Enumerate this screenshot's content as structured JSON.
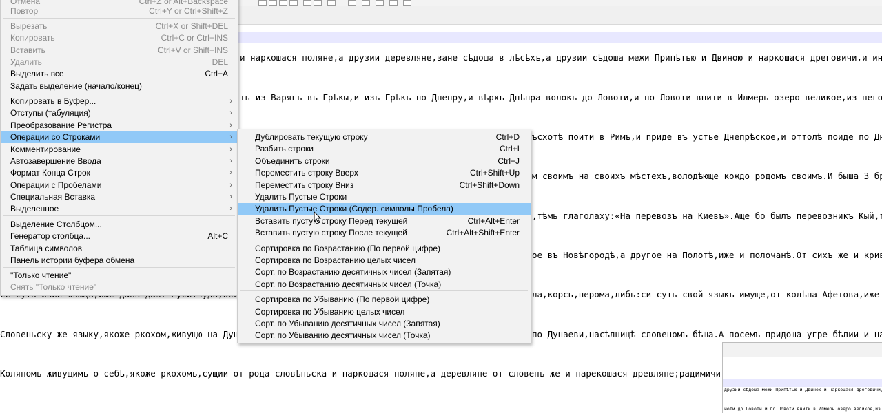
{
  "editor": {
    "lines": [
      {
        "text": "и наркошася поляне,а друзии деревляне,зане сѣдоша в лѣсѣхъ,а друзии сѣдоша межи Припѣтью и Двиною и наркошася дреговичи,и инии сѣ"
      },
      {
        "text": "ть из Варягъ въ Грѣкы,и изъ Грѣкъ по Днепру,и вѣрхъ Днѣпра волокъ до Ловоти,и по Ловоти внити в Илмерь озеро великое,из негоже оз"
      },
      {
        "text": "ъсхотѣ поити в Римъ,и приде въ устье Днепрѣское,и оттолѣ поиде по Днѣпр"
      },
      {
        "text": "м своимъ на своихъ мѣстехъ,володѣюще кождо родомъ своимъ.И быша 3 брата"
      },
      {
        "text": ",тѣмь глаголаху:«На перевозъ на Киевъ».Аще бо былъ перевозникъ Кый,то н"
      },
      {
        "text": "ое въ Новѣгородѣ,а другое на Полотѣ,иже и полочанѣ.От сихъ же и кривичи"
      },
      {
        "text": "ла,корсь,нерома,либь:си суть свой языкъ имуще,от колѣна Афетова,иже жи"
      },
      {
        "text": "по Дунаеви,насѣлницѣ словеномъ бѣша.А посемъ придоша угре бѣлии и наслѣ"
      },
      {
        "text": "Коляномъ живущимъ о себѣ,якоже ркохомъ,сущии от рода словѣньска и наркошася поляне,а деревляне от словенъ же и нарекошася древляне;радимичи бо и в"
      }
    ],
    "left_fragments": [
      {
        "text": "се суть инии языцѣ,иже дань дают Руси:чудь,вес"
      },
      {
        "text": "Словеньску же языку,якоже ркохом,живущю на Дунаи"
      }
    ],
    "minimap": {
      "lines": [
        {
          "text": "друзии сѣдоша межи Припѣтью и Двиною и наркошася дреговичи,и ни"
        },
        {
          "text": "ноти до Ловоти,и по Ловоти внити в Илмерь озеро великое,из не"
        }
      ]
    }
  },
  "edit_menu": {
    "items": [
      {
        "label": "Отмена",
        "shortcut": "Ctrl+Z or Alt+Backspace",
        "disabled": true
      },
      {
        "label": "Повтор",
        "shortcut": "Ctrl+Y or Ctrl+Shift+Z",
        "disabled": true
      },
      {
        "label": "Вырезать",
        "shortcut": "Ctrl+X or Shift+DEL",
        "disabled": true
      },
      {
        "label": "Копировать",
        "shortcut": "Ctrl+C or Ctrl+INS",
        "disabled": true
      },
      {
        "label": "Вставить",
        "shortcut": "Ctrl+V or Shift+INS",
        "disabled": true
      },
      {
        "label": "Удалить",
        "shortcut": "DEL",
        "disabled": true
      },
      {
        "label": "Выделить все",
        "shortcut": "Ctrl+A"
      },
      {
        "label": "Задать выделение (начало/конец)",
        "shortcut": ""
      },
      {
        "label": "Копировать в Буфер...",
        "submenu": true
      },
      {
        "label": "Отступы (табуляция)",
        "submenu": true
      },
      {
        "label": "Преобразование Регистра",
        "submenu": true
      },
      {
        "label": "Операции со Строками",
        "submenu": true,
        "highlighted": true
      },
      {
        "label": "Комментирование",
        "submenu": true
      },
      {
        "label": "Автозавершение Ввода",
        "submenu": true
      },
      {
        "label": "Формат Конца Строк",
        "submenu": true
      },
      {
        "label": "Операции с Пробелами",
        "submenu": true
      },
      {
        "label": "Специальная Вставка",
        "submenu": true
      },
      {
        "label": "Выделенное",
        "submenu": true
      },
      {
        "label": "Выделение Столбцом...",
        "shortcut": ""
      },
      {
        "label": "Генератор столбца...",
        "shortcut": "Alt+C"
      },
      {
        "label": "Таблица символов",
        "shortcut": ""
      },
      {
        "label": "Панель истории буфера обмена",
        "shortcut": ""
      },
      {
        "label": "\"Только чтение\"",
        "shortcut": ""
      },
      {
        "label": "Снять \"Только чтение\"",
        "shortcut": "",
        "disabled": true
      }
    ]
  },
  "lines_submenu": {
    "items": [
      {
        "label": "Дублировать текущую строку",
        "shortcut": "Ctrl+D"
      },
      {
        "label": "Разбить строки",
        "shortcut": "Ctrl+I"
      },
      {
        "label": "Объединить строки",
        "shortcut": "Ctrl+J"
      },
      {
        "label": "Переместить строку Вверх",
        "shortcut": "Ctrl+Shift+Up"
      },
      {
        "label": "Переместить строку Вниз",
        "shortcut": "Ctrl+Shift+Down"
      },
      {
        "label": "Удалить Пустые Строки",
        "shortcut": ""
      },
      {
        "label": "Удалить Пустые Строки (Содер. символы Пробела)",
        "shortcut": "",
        "highlighted": true
      },
      {
        "label": "Вставить пустую строку Перед текущей",
        "shortcut": "Ctrl+Alt+Enter"
      },
      {
        "label": "Вставить пустую строку После текущей",
        "shortcut": "Ctrl+Alt+Shift+Enter"
      },
      {
        "label": "Сортировка по Возрастанию (По первой цифре)",
        "shortcut": ""
      },
      {
        "label": "Сортировка по Возрастанию целых чисел",
        "shortcut": ""
      },
      {
        "label": "Сорт. по Возрастанию десятичных чисел (Запятая)",
        "shortcut": ""
      },
      {
        "label": "Сорт. по Возрастанию десятичных чисел (Точка)",
        "shortcut": ""
      },
      {
        "label": "Сортировка по Убыванию (По первой цифре)",
        "shortcut": ""
      },
      {
        "label": "Сортировка по Убыванию целых чисел",
        "shortcut": ""
      },
      {
        "label": "Сорт. по Убыванию десятичных чисел (Запятая)",
        "shortcut": ""
      },
      {
        "label": "Сорт. по Убыванию десятичных чисел (Точка)",
        "shortcut": ""
      }
    ]
  },
  "colors": {
    "highlight": "#91c9f7",
    "menu_bg": "#f2f2f2",
    "current_line": "#e8e8ff"
  }
}
